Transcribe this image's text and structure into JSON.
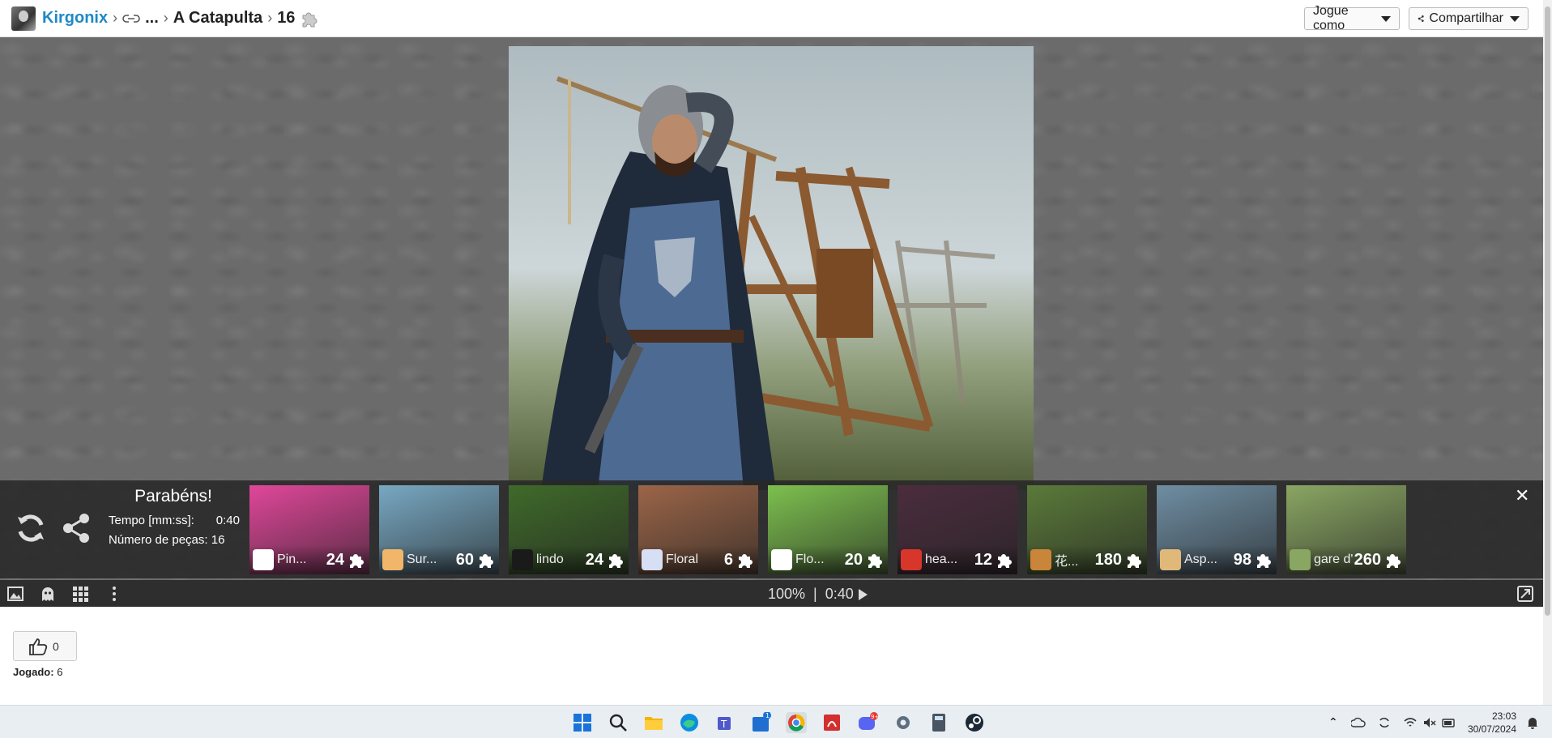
{
  "header": {
    "user": "Kirgonix",
    "ellipsis": "...",
    "title": "A Catapulta",
    "pieces": "16",
    "play_as": "Jogue como",
    "share": "Compartilhar"
  },
  "overlay": {
    "title": "Parabéns!",
    "time_label": "Tempo [mm:ss]:",
    "time_value": "0:40",
    "pieces_label": "Número de peças: 16",
    "close": "✕",
    "thumbnails": [
      {
        "label": "Pin...",
        "count": "24",
        "bg": "#e0479a",
        "badge": "#ffffff"
      },
      {
        "label": "Sur...",
        "count": "60",
        "bg": "#78a8c2",
        "badge": "#f2b66b"
      },
      {
        "label": "lindo",
        "count": "24",
        "bg": "#3f6a2a",
        "badge": "#1a1a1a"
      },
      {
        "label": "Floral",
        "count": "6",
        "bg": "#9b6548",
        "badge": "#d6dff3"
      },
      {
        "label": "Flo...",
        "count": "20",
        "bg": "#7dc04f",
        "badge": "#ffffff"
      },
      {
        "label": "hea...",
        "count": "12",
        "bg": "#4b2d3e",
        "badge": "#d8362a"
      },
      {
        "label": "花...",
        "count": "180",
        "bg": "#5b7a3a",
        "badge": "#c9853a"
      },
      {
        "label": "Asp...",
        "count": "98",
        "bg": "#6f8ea3",
        "badge": "#e0b97a"
      },
      {
        "label": "gare d'...",
        "count": "260",
        "bg": "#8aa663",
        "badge": "#8aa663"
      }
    ]
  },
  "toolbar": {
    "zoom": "100%",
    "separator": "|",
    "timer": "0:40"
  },
  "likes": {
    "count": "0",
    "played_label": "Jogado:",
    "played_value": "6"
  },
  "taskbar": {
    "time": "23:03",
    "date": "30/07/2024",
    "store_badge": "1",
    "discord_badge": "9+"
  },
  "icons": [
    "refresh-icon",
    "share-icon",
    "image-icon",
    "ghost-icon",
    "grid-icon",
    "more-icon",
    "fullscreen-icon",
    "thumbs-up-icon",
    "puzzle-piece-icon",
    "link-icon"
  ]
}
